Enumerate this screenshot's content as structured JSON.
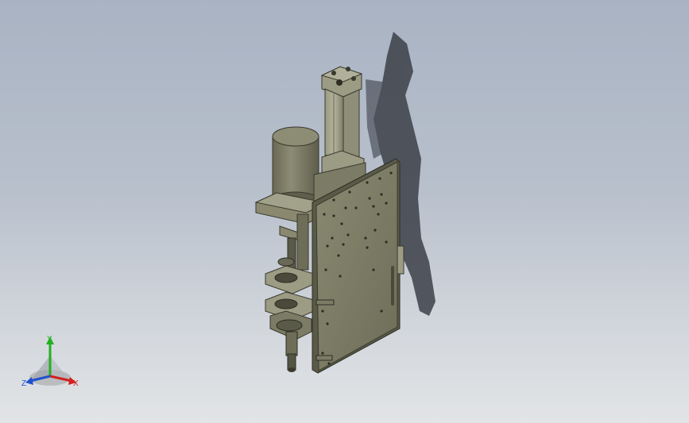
{
  "viewport": {
    "background_top": "#a9b3c3",
    "background_bottom": "#e2e4e6"
  },
  "model": {
    "body_color": "#77765f",
    "face_color": "#8a8970",
    "dark_color": "#4a4a3c",
    "shadow_color": "#3c4048"
  },
  "triad": {
    "x_label": "X",
    "y_label": "Y",
    "z_label": "Z",
    "x_color": "#d22020",
    "y_color": "#22b022",
    "z_color": "#2050d0"
  }
}
